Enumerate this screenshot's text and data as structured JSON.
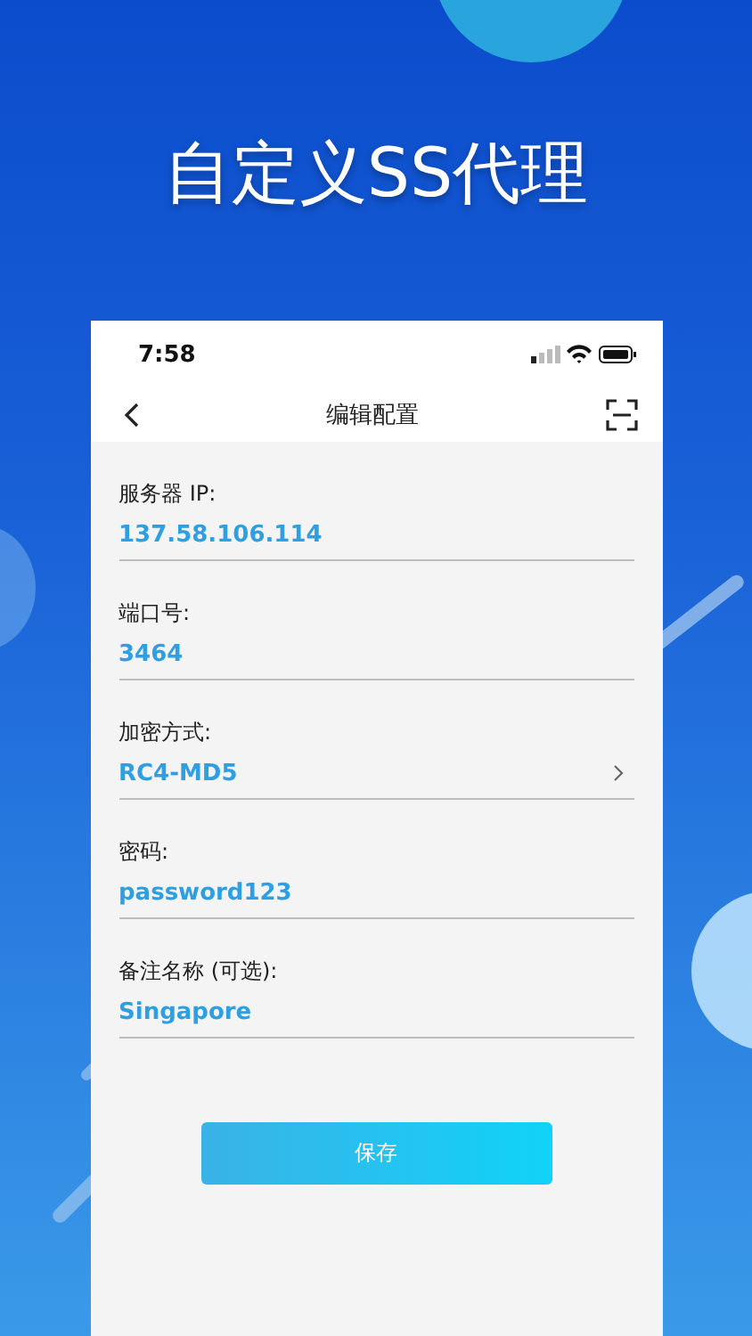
{
  "headline": "自定义SS代理",
  "status_bar": {
    "time": "7:58"
  },
  "nav": {
    "title": "编辑配置"
  },
  "fields": [
    {
      "kind": "text",
      "label": "服务器 IP:",
      "value": "137.58.106.114"
    },
    {
      "kind": "text",
      "label": "端口号:",
      "value": "3464"
    },
    {
      "kind": "select",
      "label": "加密方式:",
      "value": "RC4-MD5"
    },
    {
      "kind": "text",
      "label": "密码:",
      "value": "password123"
    },
    {
      "kind": "text",
      "label": "备注名称 (可选):",
      "value": "Singapore"
    }
  ],
  "save_button": "保存"
}
